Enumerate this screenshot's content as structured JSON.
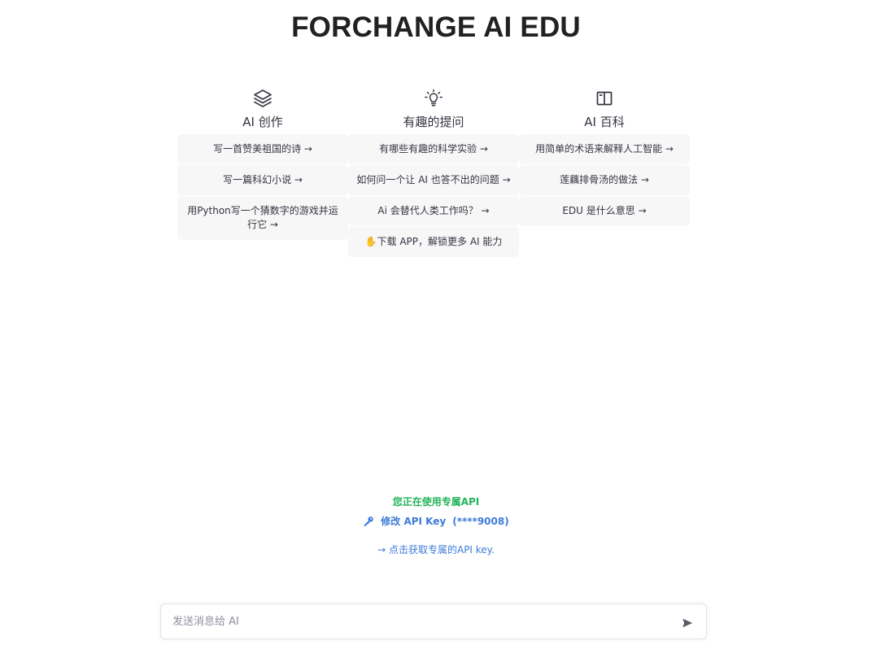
{
  "header": {
    "title": "FORCHANGE AI EDU"
  },
  "columns": [
    {
      "icon": "layers-icon",
      "title": "AI 创作",
      "prompts": [
        "写一首赞美祖国的诗 →",
        "写一篇科幻小说 →",
        "用Python写一个猜数字的游戏并运行它 →"
      ]
    },
    {
      "icon": "lightbulb-icon",
      "title": "有趣的提问",
      "prompts": [
        "有哪些有趣的科学实验 →",
        "如何问一个让 AI 也答不出的问题 →",
        "Ai 会替代人类工作吗？ →",
        "✋下载 APP，解锁更多 AI 能力"
      ]
    },
    {
      "icon": "book-icon",
      "title": "AI 百科",
      "prompts": [
        "用简单的术语来解释人工智能 →",
        "莲藕排骨汤的做法 →",
        "EDU 是什么意思 →"
      ]
    }
  ],
  "api": {
    "status_text": "您正在使用专属API",
    "edit_key_label": "修改 API Key",
    "masked_key": "(****9008)",
    "get_key_link": "→ 点击获取专属的API key."
  },
  "composer": {
    "placeholder": "发送消息给 AI"
  },
  "colors": {
    "status_green": "#22b45a",
    "link_blue": "#3c7bd9",
    "card_bg": "#f7f7f8"
  }
}
